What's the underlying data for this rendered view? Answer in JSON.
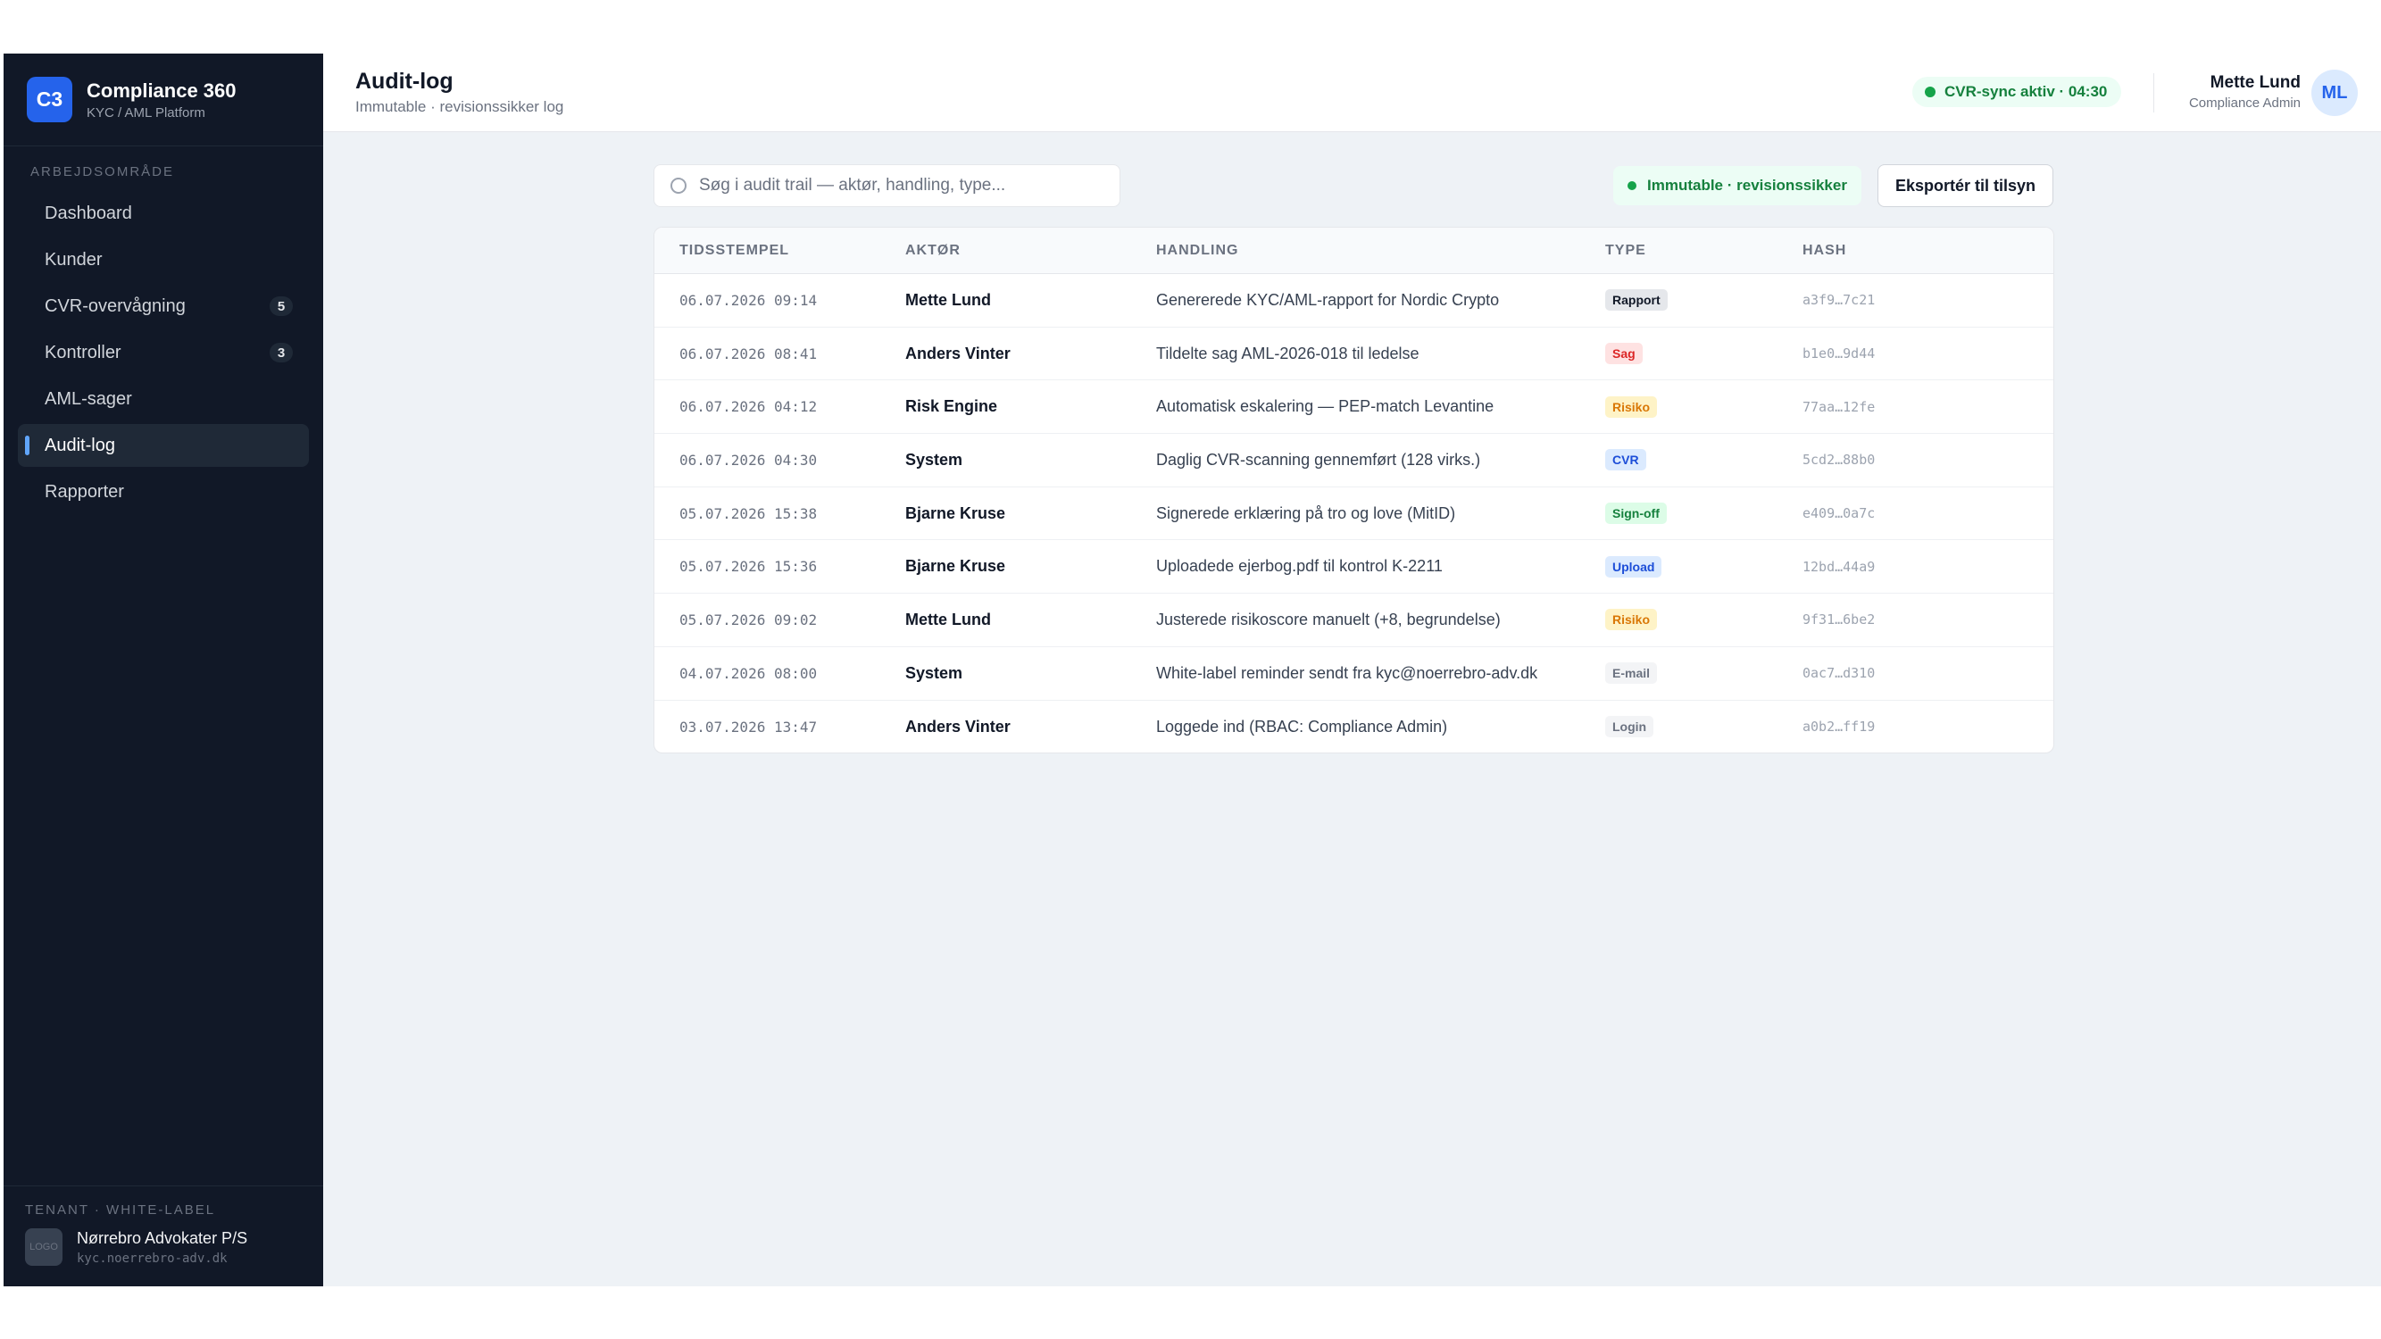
{
  "brand": {
    "logo": "C3",
    "title": "Compliance 360",
    "subtitle": "KYC / AML Platform"
  },
  "sidebar": {
    "section_label": "ARBEJDSOMRÅDE",
    "items": [
      {
        "label": "Dashboard",
        "count": ""
      },
      {
        "label": "Kunder",
        "count": ""
      },
      {
        "label": "CVR-overvågning",
        "count": "5"
      },
      {
        "label": "Kontroller",
        "count": "3"
      },
      {
        "label": "AML-sager",
        "count": ""
      },
      {
        "label": "Audit-log",
        "count": "",
        "active": true
      },
      {
        "label": "Rapporter",
        "count": ""
      }
    ],
    "tenant": {
      "label": "TENANT · WHITE-LABEL",
      "logo": "LOGO",
      "name": "Nørrebro Advokater P/S",
      "url": "kyc.noerrebro-adv.dk"
    }
  },
  "header": {
    "title": "Audit-log",
    "subtitle": "Immutable · revisionssikker log",
    "sync_status": "CVR-sync aktiv · 04:30",
    "user_name": "Mette Lund",
    "user_role": "Compliance Admin",
    "avatar_initials": "ML"
  },
  "toolbar": {
    "search_placeholder": "Søg i audit trail — aktør, handling, type...",
    "immutable_label": "Immutable · revisionssikker",
    "export_label": "Eksportér til tilsyn"
  },
  "table": {
    "columns": [
      "TIDSSTEMPEL",
      "AKTØR",
      "HANDLING",
      "TYPE",
      "HASH"
    ],
    "rows": [
      {
        "timestamp": "06.07.2026 09:14",
        "actor": "Mette Lund",
        "action": "Genererede KYC/AML-rapport for Nordic Crypto",
        "type": "Rapport",
        "hash": "a3f9…7c21"
      },
      {
        "timestamp": "06.07.2026 08:41",
        "actor": "Anders Vinter",
        "action": "Tildelte sag AML-2026-018 til ledelse",
        "type": "Sag",
        "hash": "b1e0…9d44"
      },
      {
        "timestamp": "06.07.2026 04:12",
        "actor": "Risk Engine",
        "action": "Automatisk eskalering — PEP-match Levantine",
        "type": "Risiko",
        "hash": "77aa…12fe"
      },
      {
        "timestamp": "06.07.2026 04:30",
        "actor": "System",
        "action": "Daglig CVR-scanning gennemført (128 virks.)",
        "type": "CVR",
        "hash": "5cd2…88b0"
      },
      {
        "timestamp": "05.07.2026 15:38",
        "actor": "Bjarne Kruse",
        "action": "Signerede erklæring på tro og love (MitID)",
        "type": "Sign-off",
        "hash": "e409…0a7c"
      },
      {
        "timestamp": "05.07.2026 15:36",
        "actor": "Bjarne Kruse",
        "action": "Uploadede ejerbog.pdf til kontrol K-2211",
        "type": "Upload",
        "hash": "12bd…44a9"
      },
      {
        "timestamp": "05.07.2026 09:02",
        "actor": "Mette Lund",
        "action": "Justerede risikoscore manuelt (+8, begrundelse)",
        "type": "Risiko",
        "hash": "9f31…6be2"
      },
      {
        "timestamp": "04.07.2026 08:00",
        "actor": "System",
        "action": "White-label reminder sendt fra kyc@noerrebro-adv.dk",
        "type": "E-mail",
        "hash": "0ac7…d310"
      },
      {
        "timestamp": "03.07.2026 13:47",
        "actor": "Anders Vinter",
        "action": "Loggede ind (RBAC: Compliance Admin)",
        "type": "Login",
        "hash": "a0b2…ff19"
      }
    ]
  },
  "type_colors": {
    "Rapport": {
      "bg": "#e5e7eb",
      "fg": "#111827"
    },
    "Sag": {
      "bg": "#fee2e2",
      "fg": "#dc2626"
    },
    "Risiko": {
      "bg": "#fef3c7",
      "fg": "#d97706"
    },
    "CVR": {
      "bg": "#dbeafe",
      "fg": "#1d4ed8"
    },
    "Sign-off": {
      "bg": "#dcfce7",
      "fg": "#15803d"
    },
    "Upload": {
      "bg": "#dbeafe",
      "fg": "#1d4ed8"
    },
    "E-mail": {
      "bg": "#f3f4f6",
      "fg": "#6b7280"
    },
    "Login": {
      "bg": "#f3f4f6",
      "fg": "#6b7280"
    }
  }
}
